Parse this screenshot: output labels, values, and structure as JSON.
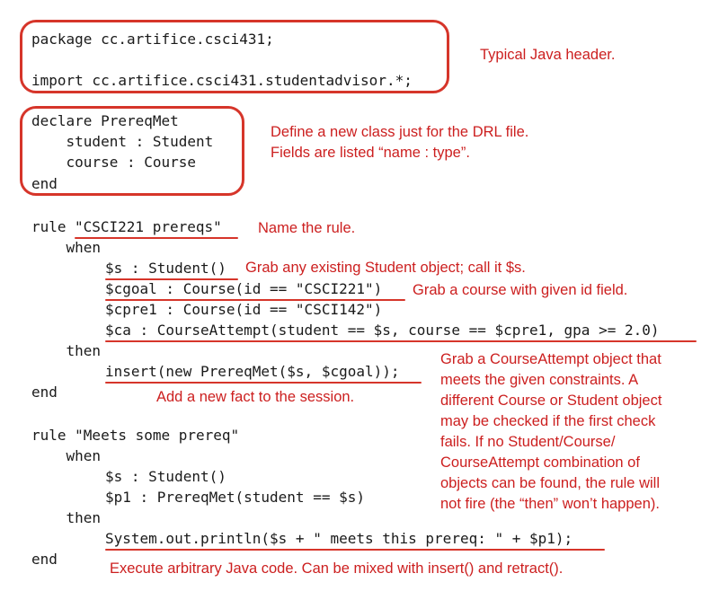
{
  "header": {
    "package_line": "package cc.artifice.csci431;",
    "import_line": "import cc.artifice.csci431.studentadvisor.*;",
    "note": "Typical Java header."
  },
  "declare": {
    "line1": "declare PrereqMet",
    "line2": "    student : Student",
    "line3": "    course : Course",
    "line4": "end",
    "note1": "Define a new class just for the DRL file.",
    "note2": "Fields are listed “name : type”."
  },
  "rule1": {
    "rule_kw": "rule ",
    "rule_name": "\"CSCI221 prereqs\"",
    "name_note": "Name the rule.",
    "when": "    when",
    "s_line": "$s : Student()",
    "s_note": "Grab any existing Student object; call it $s.",
    "cgoal_line": "$cgoal : Course(id == \"CSCI221\")",
    "cgoal_note": "Grab a course with given id field.",
    "cpre1_line": "$cpre1 : Course(id == \"CSCI142\")",
    "ca_line": "$ca : CourseAttempt(student == $s, course == $cpre1, gpa >= 2.0)",
    "then": "    then",
    "insert_line": "insert(new PrereqMet($s, $cgoal));",
    "end": "end",
    "insert_note": "Add a new fact to the session.",
    "ca_note": [
      "Grab a CourseAttempt object that",
      "meets the given constraints. A",
      "different Course or Student object",
      "may be checked if the first check",
      "fails. If no Student/Course/",
      "CourseAttempt combination of",
      "objects can be found, the rule will",
      "not fire (the “then” won’t happen)."
    ]
  },
  "rule2": {
    "rule_line": "rule \"Meets some prereq\"",
    "when": "    when",
    "s_line": "$s : Student()",
    "p1_line": "$p1 : PrereqMet(student == $s)",
    "then": "    then",
    "println_line": "System.out.println($s + \" meets this prereq: \" + $p1);",
    "end": "end",
    "note": "Execute arbitrary Java code. Can be mixed with insert() and retract()."
  },
  "colors": {
    "accent": "#d6352a",
    "note_text": "#cc1f1f",
    "code_text": "#1a1a1a"
  }
}
